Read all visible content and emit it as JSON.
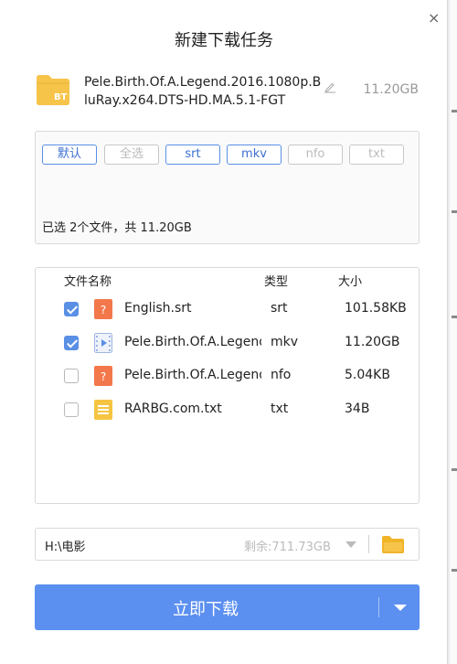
{
  "dialog": {
    "title": "新建下载任务",
    "close_glyph": "×",
    "torrent_name": "Pele.Birth.Of.A.Legend.2016.1080p.BluRay.x264.DTS-HD.MA.5.1-FGT",
    "folder_badge": "BT",
    "total_size": "11.20GB"
  },
  "filters": {
    "chips": [
      {
        "label": "默认",
        "active": true
      },
      {
        "label": "全选",
        "active": false
      },
      {
        "label": "srt",
        "active": true
      },
      {
        "label": "mkv",
        "active": true
      },
      {
        "label": "nfo",
        "active": false
      },
      {
        "label": "txt",
        "active": false
      }
    ],
    "summary": "已选 2个文件，共 11.20GB"
  },
  "file_list": {
    "columns": {
      "name": "文件名称",
      "type": "类型",
      "size": "大小"
    },
    "rows": [
      {
        "checked": true,
        "icon": "srt-file-icon",
        "icon_glyph": "?",
        "name": "English.srt",
        "type": "srt",
        "size": "101.58KB"
      },
      {
        "checked": true,
        "icon": "video-file-icon",
        "icon_glyph": "",
        "name": "Pele.Birth.Of.A.Legend...",
        "type": "mkv",
        "size": "11.20GB"
      },
      {
        "checked": false,
        "icon": "nfo-file-icon",
        "icon_glyph": "?",
        "name": "Pele.Birth.Of.A.Legend...",
        "type": "nfo",
        "size": "5.04KB"
      },
      {
        "checked": false,
        "icon": "text-file-icon",
        "icon_glyph": "",
        "name": "RARBG.com.txt",
        "type": "txt",
        "size": "34B"
      }
    ]
  },
  "save_path": {
    "path": "H:\\电影",
    "free_space": "剩余:711.73GB"
  },
  "download_button": {
    "label": "立即下载"
  },
  "colors": {
    "accent": "#5b8ff0",
    "folder": "#f7c44a",
    "srt_icon": "#f2784b",
    "txt_icon": "#f5c542"
  }
}
